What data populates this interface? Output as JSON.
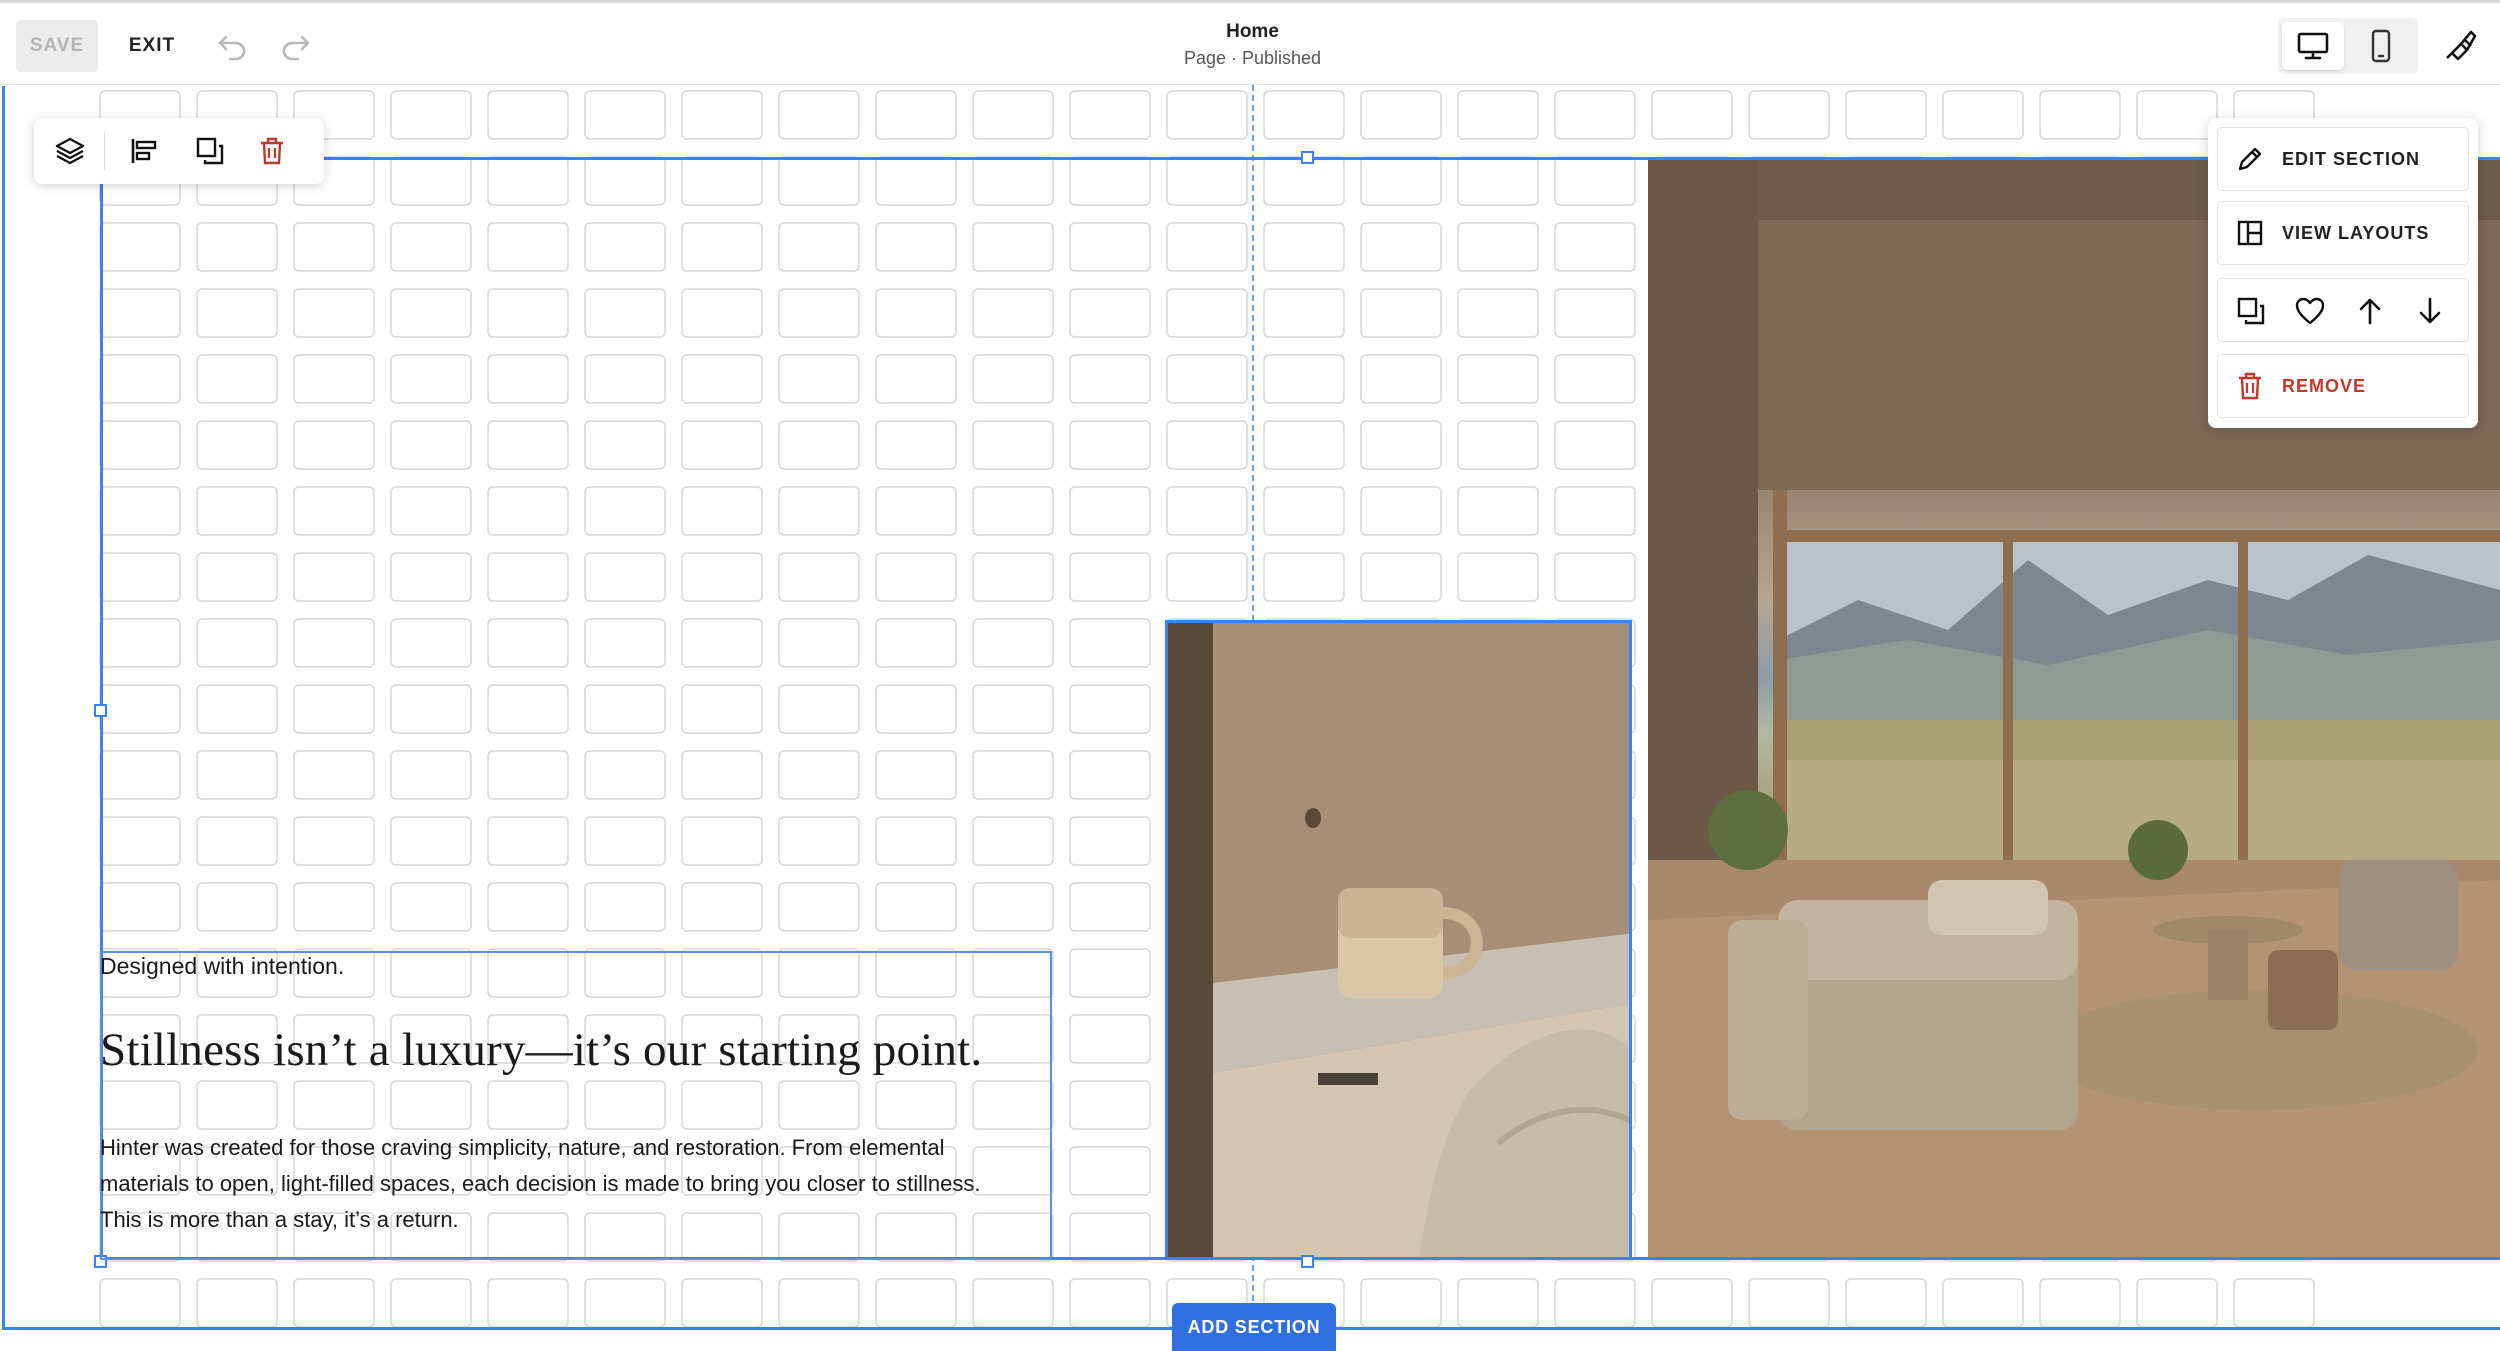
{
  "toolbar": {
    "save_label": "SAVE",
    "exit_label": "EXIT",
    "undo_icon": "undo-icon",
    "redo_icon": "redo-icon"
  },
  "header": {
    "title": "Home",
    "status": "Page · Published"
  },
  "view_toggle": {
    "desktop_icon": "desktop-icon",
    "mobile_icon": "mobile-icon",
    "design_icon": "paintbrush-icon"
  },
  "block_toolbar": {
    "icons": [
      "layers-icon",
      "align-left-icon",
      "duplicate-icon",
      "trash-icon"
    ]
  },
  "section_menu": {
    "edit_label": "EDIT SECTION",
    "layouts_label": "VIEW LAYOUTS",
    "remove_label": "REMOVE",
    "actions": [
      "duplicate-icon",
      "heart-icon",
      "arrow-up-icon",
      "arrow-down-icon"
    ]
  },
  "content": {
    "kicker": "Designed with intention.",
    "headline": "Stillness isn’t a luxury—it’s our starting point.",
    "body_lines": [
      "Hinter was created for those craving simplicity, nature, and restoration. From elemental",
      "materials to open, light-filled spaces, each decision is made to bring you closer to stillness.",
      "This is more than a stay, it’s a return."
    ]
  },
  "footer": {
    "add_section_label": "ADD SECTION",
    "spacing_icon": "spacing-icon"
  },
  "colors": {
    "accent": "#3b82f6",
    "button_blue": "#2f6fe0",
    "danger": "#c0392b",
    "grid_cell": "#d6d6d6"
  }
}
